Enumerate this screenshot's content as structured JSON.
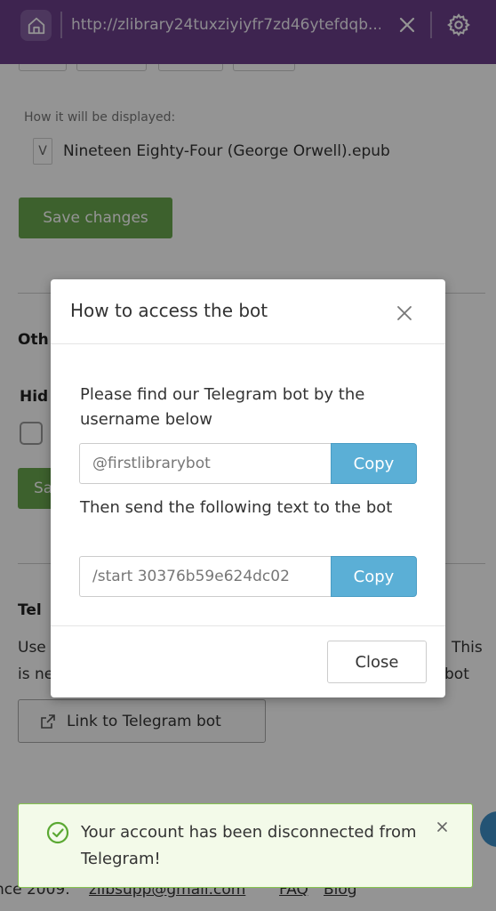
{
  "browser": {
    "url": "http://zlibrary24tuxziyiyfr7zd46ytefdqb..."
  },
  "page": {
    "display_label": "How it will be displayed:",
    "file_icon_letter": "V",
    "file_name": "Nineteen Eighty-Four (George Orwell).epub",
    "save_changes": "Save changes",
    "section_other_partial": "Oth",
    "hide_partial": "Hid",
    "save_partial": "Sa",
    "telegram_partial": "Tel",
    "desc_line1_left": "Use",
    "desc_line1_right": "This",
    "desc_line2_left": "is ne",
    "desc_line2_right": "bot",
    "link_button": "Link to Telegram bot"
  },
  "footer": {
    "since": "nce 2009.",
    "email": "zlibsupp@gmail.com",
    "faq": "FAQ",
    "blog": "Blog"
  },
  "modal": {
    "title": "How to access the bot",
    "instruction1": "Please find our Telegram bot by the username below",
    "username": "@firstlibrarybot",
    "copy1": "Copy",
    "instruction2": "Then send the following text to the bot",
    "start_command": "/start 30376b59e624dc02",
    "copy2": "Copy",
    "close": "Close"
  },
  "toast": {
    "message": "Your account has been disconnected from Telegram!"
  },
  "colors": {
    "topbar": "#6b3f8a",
    "save_green": "#6aa84f",
    "copy_blue": "#5bafd6",
    "toast_border": "#86c54f"
  }
}
